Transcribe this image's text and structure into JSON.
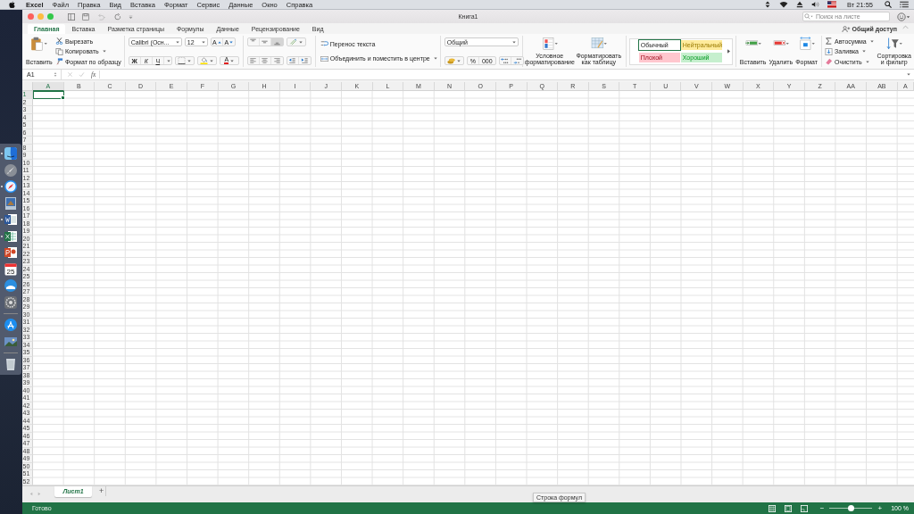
{
  "menubar": {
    "app": "Excel",
    "items": [
      "Файл",
      "Правка",
      "Вид",
      "Вставка",
      "Формат",
      "Сервис",
      "Данные",
      "Окно",
      "Справка"
    ],
    "clock": "Вт 21:55"
  },
  "dock": {
    "items": [
      {
        "kind": "finder",
        "running": true
      },
      {
        "kind": "launchpad",
        "running": false
      },
      {
        "kind": "safari",
        "running": true
      },
      {
        "kind": "preview",
        "running": false
      },
      {
        "kind": "word",
        "running": true
      },
      {
        "kind": "excel",
        "running": true
      },
      {
        "kind": "powerpoint",
        "running": false
      },
      {
        "kind": "calendar",
        "running": false,
        "label": "25"
      },
      {
        "kind": "drive",
        "running": false
      },
      {
        "kind": "settings",
        "running": false
      },
      {
        "kind": "separator"
      },
      {
        "kind": "appstore",
        "running": false
      },
      {
        "kind": "photos",
        "running": false
      },
      {
        "kind": "separator"
      },
      {
        "kind": "trash",
        "running": false
      }
    ]
  },
  "window": {
    "title": "Книга1",
    "search": {
      "placeholder": "Поиск на листе"
    },
    "share": "Общий доступ"
  },
  "tabs": [
    {
      "label": "Главная",
      "selected": true
    },
    {
      "label": "Вставка",
      "selected": false
    },
    {
      "label": "Разметка страницы",
      "selected": false
    },
    {
      "label": "Формулы",
      "selected": false
    },
    {
      "label": "Данные",
      "selected": false
    },
    {
      "label": "Рецензирование",
      "selected": false
    },
    {
      "label": "Вид",
      "selected": false
    }
  ],
  "ribbon": {
    "clipboard": {
      "paste": "Вставить",
      "cut": "Вырезать",
      "copy": "Копировать",
      "format_painter": "Формат по образцу"
    },
    "font": {
      "name": "Calibri (Осн...",
      "size": "12",
      "grow": "A",
      "shrink": "A",
      "bold": "Ж",
      "italic": "К",
      "underline": "Ч",
      "text_color": "A"
    },
    "vertical_align": [
      {
        "kind": "top",
        "selected": false
      },
      {
        "kind": "middle",
        "selected": false
      },
      {
        "kind": "bottom",
        "selected": true
      }
    ],
    "wrap_text": "Перенос текста",
    "merge": "Объединить и поместить в центре",
    "number": {
      "format": "Общий",
      "percent": "%",
      "thousands": "000"
    },
    "conditional": "Условное форматирование",
    "format_table": "Форматировать как таблицу",
    "styles": [
      {
        "label": "Обычный",
        "color": "#ffffff",
        "selected": true
      },
      {
        "label": "Нейтральный",
        "color": "#ffeb9c",
        "selected": false
      },
      {
        "label": "Плохой",
        "color": "#ffc7ce",
        "selected": false
      },
      {
        "label": "Хороший",
        "color": "#c6efce",
        "selected": false
      }
    ],
    "cells": {
      "insert": "Вставить",
      "delete": "Удалить",
      "format": "Формат"
    },
    "editing": {
      "autosum": "Автосумма",
      "fill": "Заливка",
      "clear": "Очистить",
      "sort": "Сортировка и фильтр"
    }
  },
  "formula_bar": {
    "name_box": "A1",
    "fx": "fx"
  },
  "sheet": {
    "columns": [
      {
        "label": "A",
        "selected": true
      },
      {
        "label": "B",
        "selected": false
      },
      {
        "label": "C",
        "selected": false
      },
      {
        "label": "D",
        "selected": false
      },
      {
        "label": "E",
        "selected": false
      },
      {
        "label": "F",
        "selected": false
      },
      {
        "label": "G",
        "selected": false
      },
      {
        "label": "H",
        "selected": false
      },
      {
        "label": "I",
        "selected": false
      },
      {
        "label": "J",
        "selected": false
      },
      {
        "label": "K",
        "selected": false
      },
      {
        "label": "L",
        "selected": false
      },
      {
        "label": "M",
        "selected": false
      },
      {
        "label": "N",
        "selected": false
      },
      {
        "label": "O",
        "selected": false
      },
      {
        "label": "P",
        "selected": false
      },
      {
        "label": "Q",
        "selected": false
      },
      {
        "label": "R",
        "selected": false
      },
      {
        "label": "S",
        "selected": false
      },
      {
        "label": "T",
        "selected": false
      },
      {
        "label": "U",
        "selected": false
      },
      {
        "label": "V",
        "selected": false
      },
      {
        "label": "W",
        "selected": false
      },
      {
        "label": "X",
        "selected": false
      },
      {
        "label": "Y",
        "selected": false
      },
      {
        "label": "Z",
        "selected": false
      },
      {
        "label": "AA",
        "selected": false
      },
      {
        "label": "AB",
        "selected": false
      },
      {
        "label": "A",
        "selected": false
      }
    ],
    "rows": [
      {
        "label": "1",
        "selected": true
      },
      {
        "label": "2",
        "selected": false
      },
      {
        "label": "3",
        "selected": false
      },
      {
        "label": "4",
        "selected": false
      },
      {
        "label": "5",
        "selected": false
      },
      {
        "label": "6",
        "selected": false
      },
      {
        "label": "7",
        "selected": false
      },
      {
        "label": "8",
        "selected": false
      },
      {
        "label": "9",
        "selected": false
      },
      {
        "label": "10",
        "selected": false
      },
      {
        "label": "11",
        "selected": false
      },
      {
        "label": "12",
        "selected": false
      },
      {
        "label": "13",
        "selected": false
      },
      {
        "label": "14",
        "selected": false
      },
      {
        "label": "15",
        "selected": false
      },
      {
        "label": "16",
        "selected": false
      },
      {
        "label": "17",
        "selected": false
      },
      {
        "label": "18",
        "selected": false
      },
      {
        "label": "19",
        "selected": false
      },
      {
        "label": "20",
        "selected": false
      },
      {
        "label": "21",
        "selected": false
      },
      {
        "label": "22",
        "selected": false
      },
      {
        "label": "23",
        "selected": false
      },
      {
        "label": "24",
        "selected": false
      },
      {
        "label": "25",
        "selected": false
      },
      {
        "label": "26",
        "selected": false
      },
      {
        "label": "27",
        "selected": false
      },
      {
        "label": "28",
        "selected": false
      },
      {
        "label": "29",
        "selected": false
      },
      {
        "label": "30",
        "selected": false
      },
      {
        "label": "31",
        "selected": false
      },
      {
        "label": "32",
        "selected": false
      },
      {
        "label": "33",
        "selected": false
      },
      {
        "label": "34",
        "selected": false
      },
      {
        "label": "35",
        "selected": false
      },
      {
        "label": "36",
        "selected": false
      },
      {
        "label": "37",
        "selected": false
      },
      {
        "label": "38",
        "selected": false
      },
      {
        "label": "39",
        "selected": false
      },
      {
        "label": "40",
        "selected": false
      },
      {
        "label": "41",
        "selected": false
      },
      {
        "label": "42",
        "selected": false
      },
      {
        "label": "43",
        "selected": false
      },
      {
        "label": "44",
        "selected": false
      },
      {
        "label": "45",
        "selected": false
      },
      {
        "label": "46",
        "selected": false
      },
      {
        "label": "47",
        "selected": false
      },
      {
        "label": "48",
        "selected": false
      },
      {
        "label": "49",
        "selected": false
      },
      {
        "label": "50",
        "selected": false
      },
      {
        "label": "51",
        "selected": false
      },
      {
        "label": "52",
        "selected": false
      }
    ]
  },
  "sheet_tabs": {
    "tabs": [
      {
        "label": "Лист1",
        "selected": true
      }
    ],
    "add": "+"
  },
  "tooltip": "Строка формул",
  "status_bar": {
    "text": "Готово",
    "zoom_out": "−",
    "zoom_in": "+",
    "zoom": {
      "level": 0.5,
      "reading": "100 %"
    }
  }
}
